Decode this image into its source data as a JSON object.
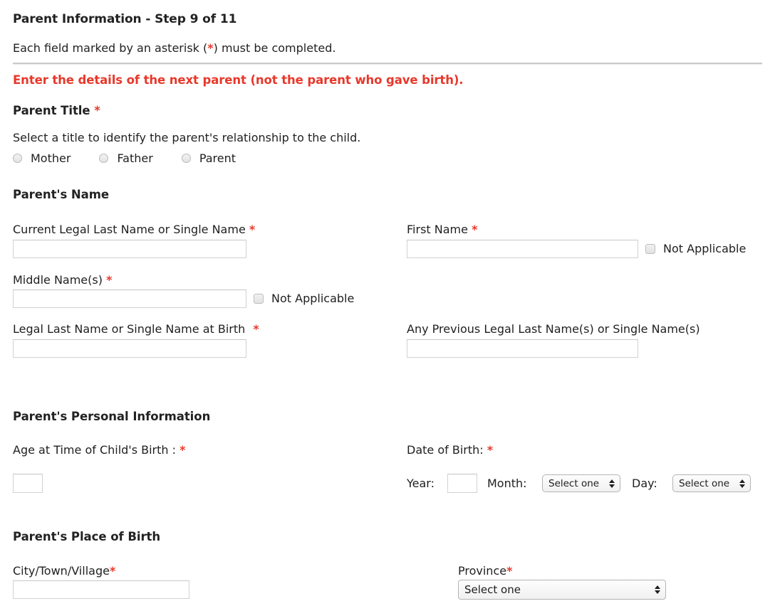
{
  "header": {
    "step_title": "Parent Information - Step 9 of 11",
    "asterisk_note_before": "Each field marked by an asterisk (",
    "asterisk_symbol": "*",
    "asterisk_note_after": ") must be completed.",
    "warning": "Enter the details of the next parent (not the parent who gave birth)."
  },
  "parent_title": {
    "heading": "Parent Title",
    "required_mark": "*",
    "instruction": "Select a title to identify the parent's relationship to the child.",
    "options": [
      {
        "label": "Mother",
        "selected": false
      },
      {
        "label": "Father",
        "selected": false
      },
      {
        "label": "Parent",
        "selected": false
      }
    ]
  },
  "parents_name": {
    "heading": "Parent's Name",
    "current_legal_last_name": {
      "label": "Current Legal Last Name or Single Name",
      "required_mark": "*",
      "value": ""
    },
    "first_name": {
      "label": "First Name",
      "required_mark": "*",
      "value": "",
      "not_applicable_label": "Not Applicable",
      "not_applicable_checked": false
    },
    "middle_names": {
      "label": "Middle Name(s)",
      "required_mark": "*",
      "value": "",
      "not_applicable_label": "Not Applicable",
      "not_applicable_checked": false
    },
    "legal_last_name_at_birth": {
      "label": "Legal Last Name or Single Name at Birth",
      "required_mark": "*",
      "value": ""
    },
    "previous_legal_last_names": {
      "label": "Any Previous Legal Last Name(s) or Single Name(s)",
      "value": ""
    }
  },
  "personal_information": {
    "heading": "Parent's Personal Information",
    "age_at_birth": {
      "label": "Age at Time of Child's Birth :",
      "required_mark": "*",
      "value": ""
    },
    "date_of_birth": {
      "label": "Date of Birth:",
      "required_mark": "*",
      "year_label": "Year:",
      "year_value": "",
      "month_label": "Month:",
      "month_value": "Select one",
      "day_label": "Day:",
      "day_value": "Select one"
    }
  },
  "place_of_birth": {
    "heading": "Parent's Place of Birth",
    "city": {
      "label": "City/Town/Village",
      "required_mark": "*",
      "value": ""
    },
    "province": {
      "label": "Province",
      "required_mark": "*",
      "value": "Select one"
    }
  },
  "colors": {
    "required_red": "#e8382a",
    "text": "#1f1f1f",
    "border": "#d2d2d2"
  }
}
